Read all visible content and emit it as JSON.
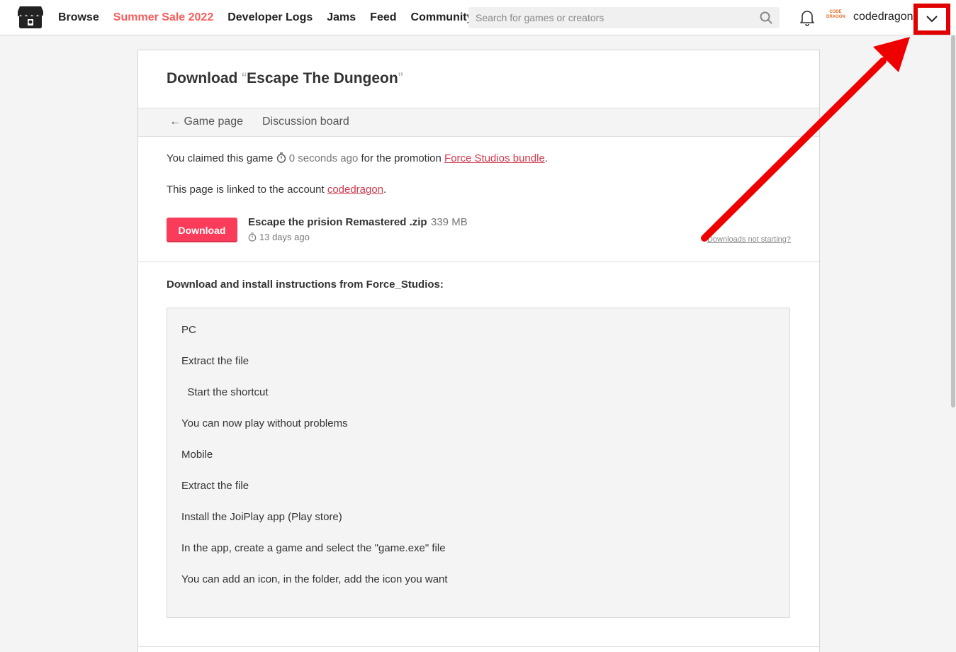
{
  "header": {
    "logo_icon": "itchio-storefront-icon",
    "nav": [
      "Browse",
      "Summer Sale 2022",
      "Developer Logs",
      "Jams",
      "Feed",
      "Community"
    ],
    "search_placeholder": "Search for games or creators",
    "avatar_text": "CODE DRAGON",
    "username": "codedragon",
    "sale_color": "#fa5c5c"
  },
  "page": {
    "title_prefix": "Download ",
    "title_open_quote": "“",
    "title_game": "Escape The Dungeon",
    "title_close_quote": "”",
    "tabs": {
      "game_page": "← Game page",
      "discussion": "Discussion board"
    },
    "claim": {
      "prefix": "You claimed this game ",
      "time": "0 seconds ago",
      "middle": " for the promotion ",
      "promotion": "Force Studios bundle",
      "suffix": "."
    },
    "linked": {
      "prefix": "This page is linked to the account ",
      "account": "codedragon",
      "suffix": "."
    },
    "download": {
      "button_label": "Download",
      "file_name": "Escape the prision Remastered .zip",
      "file_size": "339 MB",
      "file_date": "13 days ago",
      "not_starting": "Downloads not starting?",
      "button_color": "#fa3c5a"
    },
    "instructions": {
      "heading": "Download and install instructions from Force_Studios:",
      "lines": [
        "PC",
        "Extract the file",
        "  Start the shortcut",
        "You can now play without problems",
        "Mobile",
        "Extract the file",
        "Install the JoiPlay app (Play store)",
        "In the app, create a game and select the \"game.exe\" file",
        "You can add an icon, in the folder, add the icon you want"
      ]
    }
  },
  "annotation": {
    "color": "#ee0000"
  }
}
